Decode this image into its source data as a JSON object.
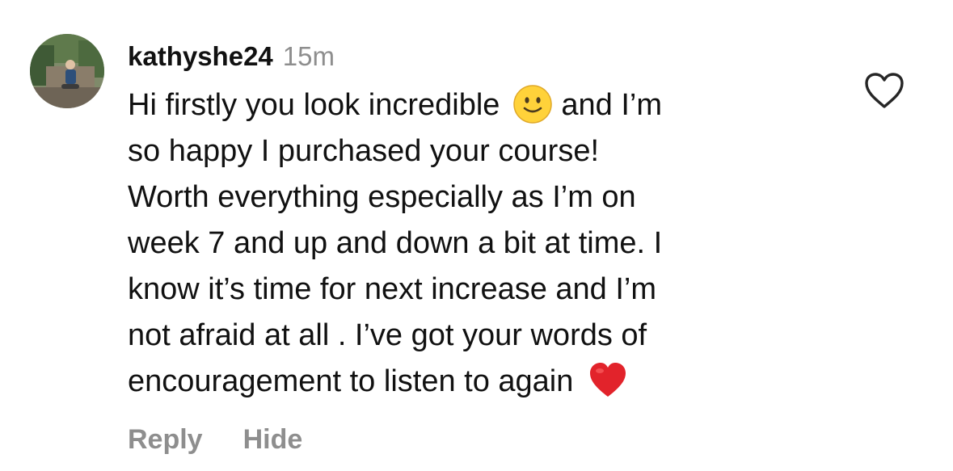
{
  "comment": {
    "username": "kathyshe24",
    "timestamp": "15m",
    "lines": [
      "Hi firstly you look incredible",
      "and I’m",
      "so happy I purchased your course!",
      "Worth everything especially as I’m on",
      "week 7 and up and down a bit at time. I",
      "know it’s time for next increase and I’m",
      "not afraid at all . I’ve got your words of",
      "encouragement to listen to again"
    ],
    "emojis": [
      "slightly-smiling-face-emoji",
      "red-heart-emoji"
    ]
  },
  "actions": {
    "reply_label": "Reply",
    "hide_label": "Hide"
  },
  "icons": {
    "like": "heart-outline-icon"
  },
  "colors": {
    "text": "#111111",
    "secondary": "#8e8e8e",
    "background": "#ffffff"
  }
}
